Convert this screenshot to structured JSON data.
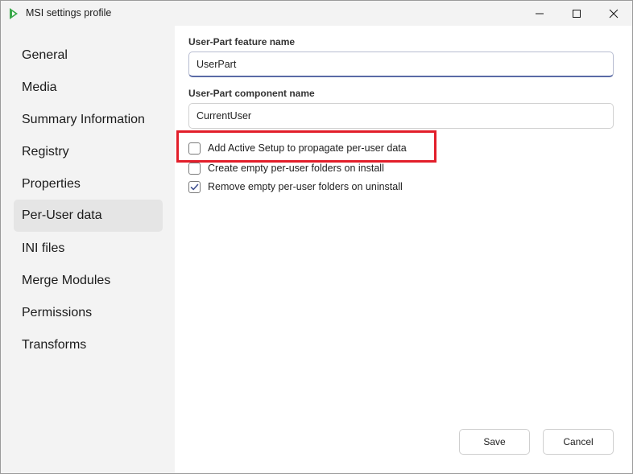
{
  "window": {
    "title": "MSI settings profile",
    "icon": "app-logo-icon",
    "controls": [
      "minimize-icon",
      "maximize-icon",
      "close-icon"
    ]
  },
  "sidebar": {
    "items": [
      {
        "label": "General",
        "active": false
      },
      {
        "label": "Media",
        "active": false
      },
      {
        "label": "Summary Information",
        "active": false
      },
      {
        "label": "Registry",
        "active": false
      },
      {
        "label": "Properties",
        "active": false
      },
      {
        "label": "Per-User data",
        "active": true
      },
      {
        "label": "INI files",
        "active": false
      },
      {
        "label": "Merge Modules",
        "active": false
      },
      {
        "label": "Permissions",
        "active": false
      },
      {
        "label": "Transforms",
        "active": false
      }
    ]
  },
  "form": {
    "feature_name": {
      "label": "User-Part feature name",
      "value": "UserPart"
    },
    "component_name": {
      "label": "User-Part component name",
      "value": "CurrentUser"
    },
    "options": [
      {
        "label": "Add Active Setup to propagate per-user data",
        "checked": false,
        "highlighted": true
      },
      {
        "label": "Create empty per-user folders on install",
        "checked": false,
        "highlighted": false
      },
      {
        "label": "Remove empty per-user folders on uninstall",
        "checked": true,
        "highlighted": false
      }
    ]
  },
  "footer": {
    "save_label": "Save",
    "cancel_label": "Cancel"
  },
  "colors": {
    "accent": "#5a6aa6",
    "check_fill": "#3f5090",
    "highlight_border": "#e21e2a",
    "app_icon": "#4caf50"
  }
}
